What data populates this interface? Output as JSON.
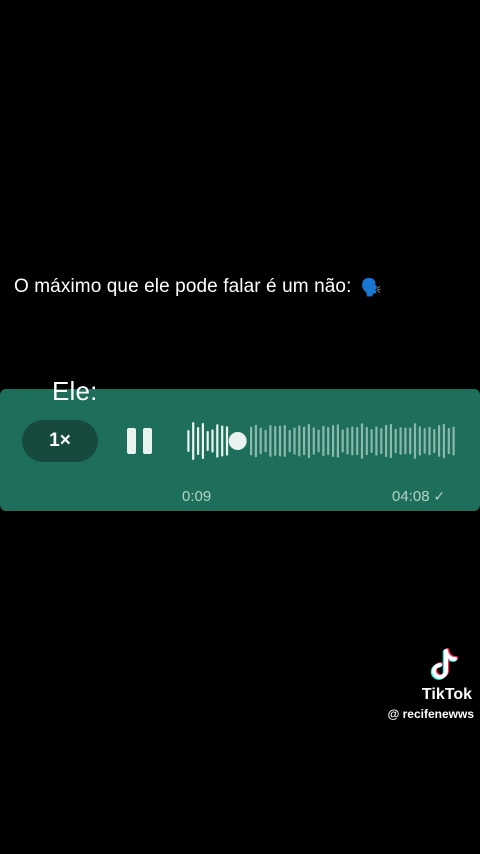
{
  "caption": {
    "text": "O máximo que ele pode falar é um não:",
    "emoji": "🗣️"
  },
  "voice_message": {
    "label": "Ele:",
    "speed": "1×",
    "elapsed": "0:09",
    "duration": "04:08",
    "progress": 0.036,
    "state": "playing",
    "icons": {
      "play_state": "pause-icon",
      "status": "check-icon"
    },
    "colors": {
      "bubble": "#1d6f5b",
      "pill": "#174a3e",
      "text_muted": "#b5d2c7",
      "waveform": "#e8f3ef"
    }
  },
  "watermark": {
    "brand": "TikTok",
    "handle": "@ recifenewws",
    "icon": "tiktok-icon"
  }
}
